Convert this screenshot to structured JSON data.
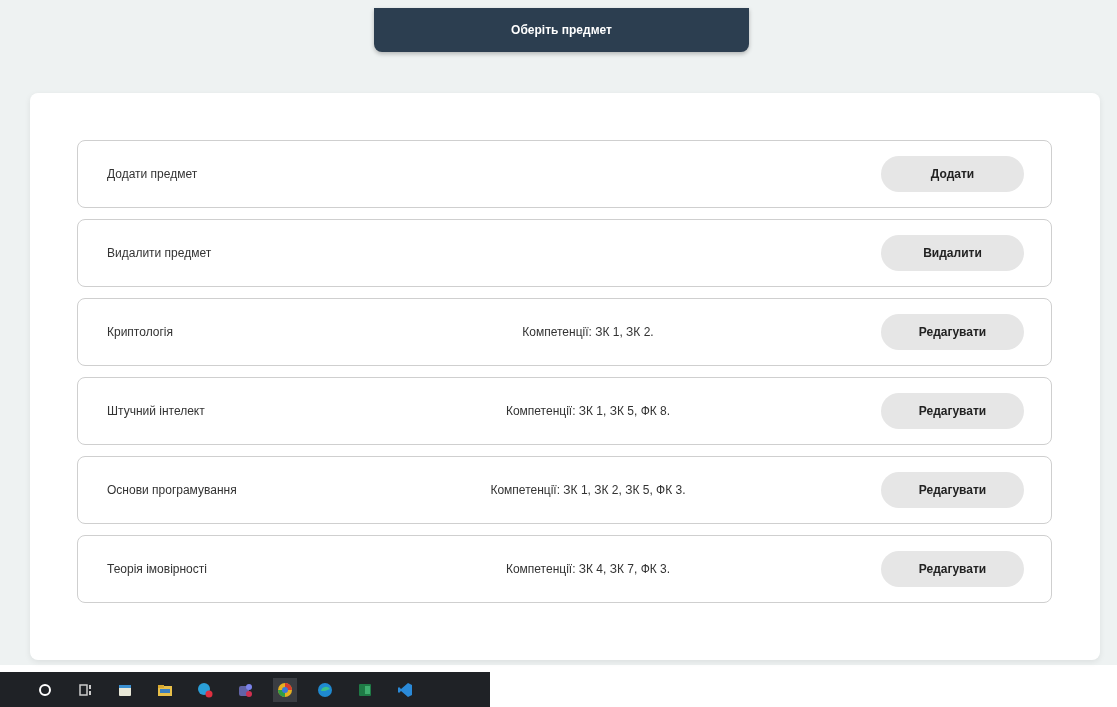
{
  "header": {
    "title": "Оберіть предмет"
  },
  "rows": [
    {
      "name": "Додати предмет",
      "button": "Додати"
    },
    {
      "name": "Видалити предмет",
      "button": "Видалити"
    },
    {
      "name": "Криптологія",
      "competencies": "Компетенції: ЗК 1, ЗК 2.",
      "button": "Редагувати"
    },
    {
      "name": "Штучний інтелект",
      "competencies": "Компетенції: ЗК 1, ЗК 5, ФК 8.",
      "button": "Редагувати"
    },
    {
      "name": "Основи програмування",
      "competencies": "Компетенції: ЗК 1, ЗК 2, ЗК 5, ФК 3.",
      "button": "Редагувати"
    },
    {
      "name": "Теорія імовірності",
      "competencies": "Компетенції: ЗК 4, ЗК 7, ФК 3.",
      "button": "Редагувати"
    }
  ]
}
